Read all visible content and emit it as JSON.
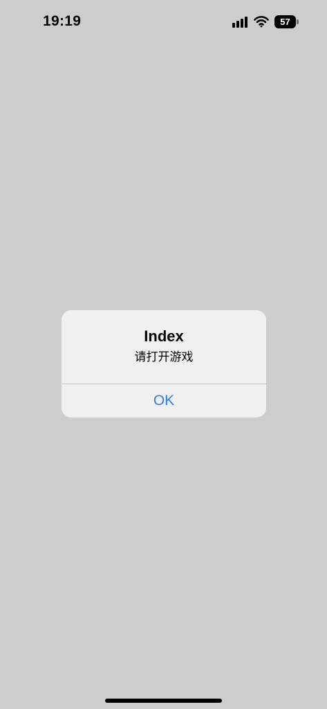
{
  "status_bar": {
    "time": "19:19",
    "battery_level": "57",
    "icons": [
      "signal-icon",
      "wifi-icon",
      "battery-icon"
    ]
  },
  "alert": {
    "title": "Index",
    "message": "请打开游戏",
    "ok_label": "OK"
  },
  "colors": {
    "background": "#cdcdcd",
    "alert_background": "#f0f0f0",
    "button_text": "#2f7ef0"
  }
}
